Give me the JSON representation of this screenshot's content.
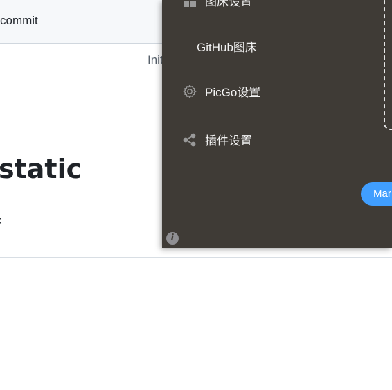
{
  "background_page": {
    "header": {
      "commit_text": "commit"
    },
    "row": {
      "message": "Init"
    },
    "heading": "static",
    "snippet": "c"
  },
  "picgo": {
    "menu": {
      "top_item": "图床设置",
      "github_item": "GitHub图床",
      "picgo_settings": "PicGo设置",
      "plugin_settings": "插件设置"
    },
    "mar_button": "Mar",
    "info_icon_glyph": "i",
    "colors": {
      "panel_bg": "#3f3b36",
      "accent": "#409eff",
      "menu_text": "#f2f2f2"
    }
  }
}
